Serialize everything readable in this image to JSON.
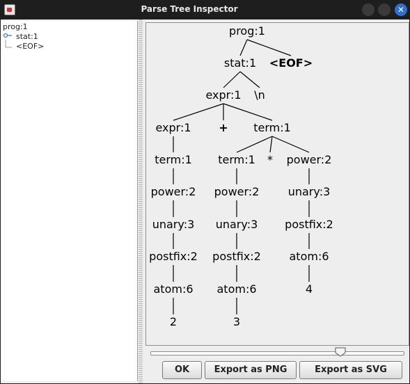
{
  "window": {
    "title": "Parse Tree Inspector"
  },
  "tree_panel": {
    "items": [
      {
        "label": "prog:1"
      },
      {
        "label": "stat:1"
      },
      {
        "label": "<EOF>"
      }
    ]
  },
  "parse_tree": {
    "nodes": [
      {
        "id": "n0",
        "label": "prog:1",
        "bold": false
      },
      {
        "id": "n1",
        "label": "stat:1",
        "bold": false
      },
      {
        "id": "n2",
        "label": "<EOF>",
        "bold": true
      },
      {
        "id": "n3",
        "label": "expr:1",
        "bold": false
      },
      {
        "id": "n4",
        "label": "\\n",
        "bold": false
      },
      {
        "id": "n5",
        "label": "expr:1",
        "bold": false
      },
      {
        "id": "n6",
        "label": "+",
        "bold": true
      },
      {
        "id": "n7",
        "label": "term:1",
        "bold": false
      },
      {
        "id": "n8",
        "label": "term:1",
        "bold": false
      },
      {
        "id": "n9",
        "label": "term:1",
        "bold": false
      },
      {
        "id": "n10",
        "label": "*",
        "bold": false
      },
      {
        "id": "n11",
        "label": "power:2",
        "bold": false
      },
      {
        "id": "n12",
        "label": "power:2",
        "bold": false
      },
      {
        "id": "n13",
        "label": "power:2",
        "bold": false
      },
      {
        "id": "n14",
        "label": "unary:3",
        "bold": false
      },
      {
        "id": "n15",
        "label": "unary:3",
        "bold": false
      },
      {
        "id": "n16",
        "label": "unary:3",
        "bold": false
      },
      {
        "id": "n17",
        "label": "postfix:2",
        "bold": false
      },
      {
        "id": "n18",
        "label": "postfix:2",
        "bold": false
      },
      {
        "id": "n19",
        "label": "postfix:2",
        "bold": false
      },
      {
        "id": "n20",
        "label": "atom:6",
        "bold": false
      },
      {
        "id": "n21",
        "label": "atom:6",
        "bold": false
      },
      {
        "id": "n22",
        "label": "atom:6",
        "bold": false
      },
      {
        "id": "n23",
        "label": "2",
        "bold": false
      },
      {
        "id": "n24",
        "label": "3",
        "bold": false
      },
      {
        "id": "n25",
        "label": "4",
        "bold": false
      }
    ],
    "edges": [
      [
        "n0",
        "n1"
      ],
      [
        "n0",
        "n2"
      ],
      [
        "n1",
        "n3"
      ],
      [
        "n1",
        "n4"
      ],
      [
        "n3",
        "n5"
      ],
      [
        "n3",
        "n6"
      ],
      [
        "n3",
        "n7"
      ],
      [
        "n5",
        "n8"
      ],
      [
        "n7",
        "n9"
      ],
      [
        "n7",
        "n10"
      ],
      [
        "n7",
        "n11"
      ],
      [
        "n8",
        "n12"
      ],
      [
        "n9",
        "n13"
      ],
      [
        "n11",
        "n14"
      ],
      [
        "n12",
        "n15"
      ],
      [
        "n13",
        "n16"
      ],
      [
        "n14",
        "n19"
      ],
      [
        "n15",
        "n17"
      ],
      [
        "n16",
        "n18"
      ],
      [
        "n19",
        "n22"
      ],
      [
        "n17",
        "n20"
      ],
      [
        "n18",
        "n21"
      ],
      [
        "n22",
        "n25"
      ],
      [
        "n20",
        "n23"
      ],
      [
        "n21",
        "n24"
      ]
    ]
  },
  "zoom": {
    "level": 0.8
  },
  "buttons": {
    "ok": "OK",
    "export_png": "Export as PNG",
    "export_svg": "Export as SVG"
  }
}
